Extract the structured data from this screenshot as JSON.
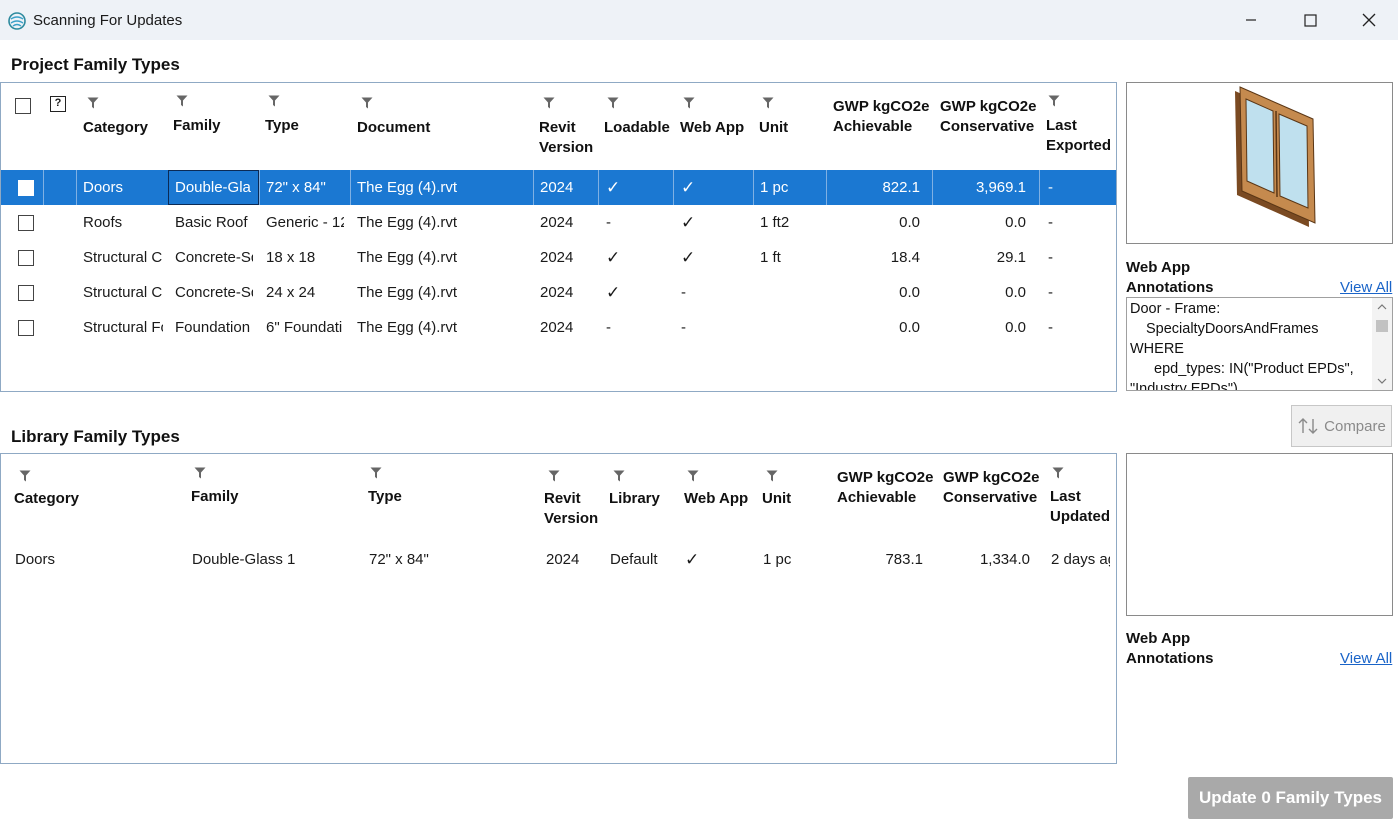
{
  "window": {
    "title": "Scanning For Updates"
  },
  "project": {
    "title": "Project Family Types",
    "headers": {
      "help": "?",
      "category": "Category",
      "family": "Family",
      "type": "Type",
      "document": "Document",
      "revit1": "Revit",
      "revit2": "Version",
      "loadable": "Loadable",
      "webapp": "Web App",
      "unit": "Unit",
      "gwp1": "GWP kgCO2e",
      "achievable": "Achievable",
      "gwp2": "GWP kgCO2e",
      "conservative": "Conservative",
      "last1": "Last",
      "exported": "Exported"
    },
    "rows": [
      {
        "category": "Doors",
        "family": "Double-Gla",
        "type": "72\" x 84\"",
        "document": "The Egg (4).rvt",
        "version": "2024",
        "loadable": "✓",
        "webapp": "✓",
        "unit": "1 pc",
        "achievable": "822.1",
        "conservative": "3,969.1",
        "exported": "-"
      },
      {
        "category": "Roofs",
        "family": "Basic Roof",
        "type": "Generic - 12",
        "document": "The Egg (4).rvt",
        "version": "2024",
        "loadable": "-",
        "webapp": "✓",
        "unit": "1 ft2",
        "achievable": "0.0",
        "conservative": "0.0",
        "exported": "-"
      },
      {
        "category": "Structural C",
        "family": "Concrete-Sq",
        "type": "18 x 18",
        "document": "The Egg (4).rvt",
        "version": "2024",
        "loadable": "✓",
        "webapp": "✓",
        "unit": "1 ft",
        "achievable": "18.4",
        "conservative": "29.1",
        "exported": "-"
      },
      {
        "category": "Structural C",
        "family": "Concrete-Sq",
        "type": "24 x 24",
        "document": "The Egg (4).rvt",
        "version": "2024",
        "loadable": "✓",
        "webapp": "-",
        "unit": "",
        "achievable": "0.0",
        "conservative": "0.0",
        "exported": "-"
      },
      {
        "category": "Structural Fo",
        "family": "Foundation",
        "type": "6\" Foundati",
        "document": "The Egg (4).rvt",
        "version": "2024",
        "loadable": "-",
        "webapp": "-",
        "unit": "",
        "achievable": "0.0",
        "conservative": "0.0",
        "exported": "-"
      }
    ],
    "annotations": {
      "label1": "Web App",
      "label2": "Annotations",
      "view_all": "View All",
      "lines": [
        "Door - Frame:",
        "SpecialtyDoorsAndFrames",
        "WHERE",
        "epd_types: IN(\"Product EPDs\",",
        "\"Industry EPDs\")"
      ]
    },
    "compare_label": "Compare"
  },
  "library": {
    "title": "Library Family Types",
    "headers": {
      "category": "Category",
      "family": "Family",
      "type": "Type",
      "revit1": "Revit",
      "revit2": "Version",
      "library": "Library",
      "webapp": "Web App",
      "unit": "Unit",
      "gwp1": "GWP kgCO2e",
      "achievable": "Achievable",
      "gwp2": "GWP kgCO2e",
      "conservative": "Conservative",
      "last1": "Last",
      "updated": "Updated"
    },
    "rows": [
      {
        "category": "Doors",
        "family": "Double-Glass 1",
        "type": "72\" x 84\"",
        "version": "2024",
        "library": "Default",
        "webapp": "✓",
        "unit": "1 pc",
        "achievable": "783.1",
        "conservative": "1,334.0",
        "updated": "2 days ag"
      }
    ],
    "annotations": {
      "label1": "Web App",
      "label2": "Annotations",
      "view_all": "View All"
    }
  },
  "footer": {
    "update_label": "Update 0 Family Types"
  },
  "colors": {
    "selection": "#1b78d2",
    "link": "#1a64c8",
    "titlebar": "#eef2f7"
  }
}
